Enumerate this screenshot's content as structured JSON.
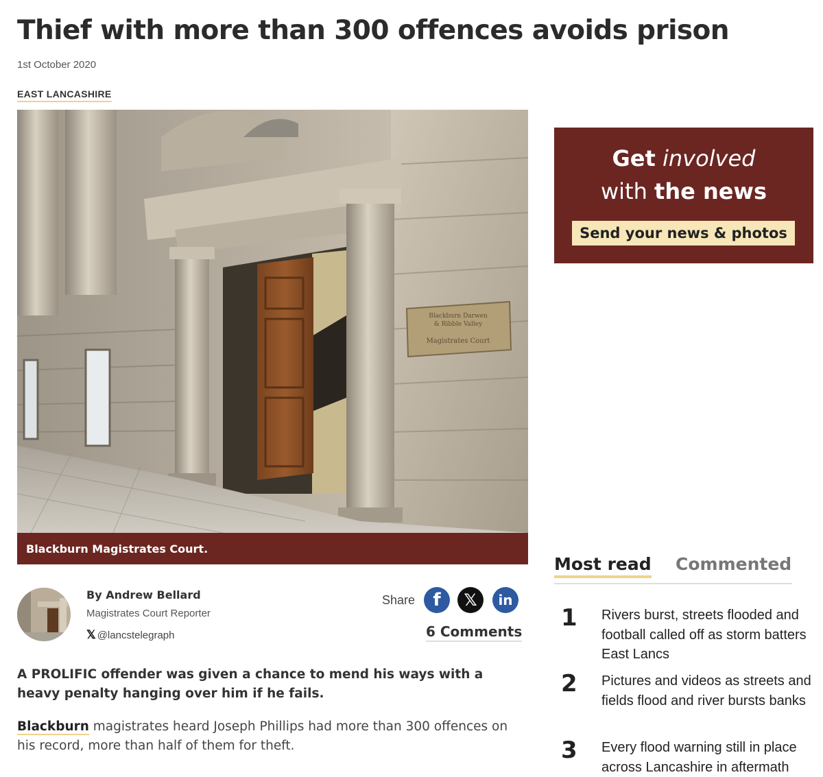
{
  "article": {
    "headline": "Thief with more than 300 offences avoids prison",
    "date": "1st October 2020",
    "section": "EAST LANCASHIRE",
    "image_caption": "Blackburn Magistrates Court.",
    "sign_text": [
      "Blackburn Darwen",
      "& Ribble Valley",
      "Magistrates Court"
    ],
    "standfirst": "A PROLIFIC offender was given a chance to mend his ways with a heavy penalty hanging over him if he fails.",
    "para1_link": "Blackburn",
    "para1_rest": " magistrates heard Joseph Phillips had more than 300 offences on his record, more than half of them for theft."
  },
  "author": {
    "name": "By Andrew Bellard",
    "role": "Magistrates Court Reporter",
    "twitter": "@lancstelegraph"
  },
  "share": {
    "label": "Share",
    "comments": "6 Comments"
  },
  "promo": {
    "get": "Get",
    "involved": "involved",
    "with": "with",
    "the_news": "the news",
    "button": "Send your news & photos"
  },
  "most_read": {
    "tabs": [
      "Most read",
      "Commented"
    ],
    "items": [
      {
        "rank": "1",
        "title": "Rivers burst, streets flooded and football called off as storm batters East Lancs"
      },
      {
        "rank": "2",
        "title": "Pictures and videos as streets and fields flood and river bursts banks"
      },
      {
        "rank": "3",
        "title": "Every flood warning still in place across Lancashire in aftermath"
      }
    ]
  },
  "colors": {
    "brand": "#6b2622",
    "accent": "#f0d28a",
    "promo_button": "#f6e6b8",
    "social": "#2d5aa0"
  }
}
